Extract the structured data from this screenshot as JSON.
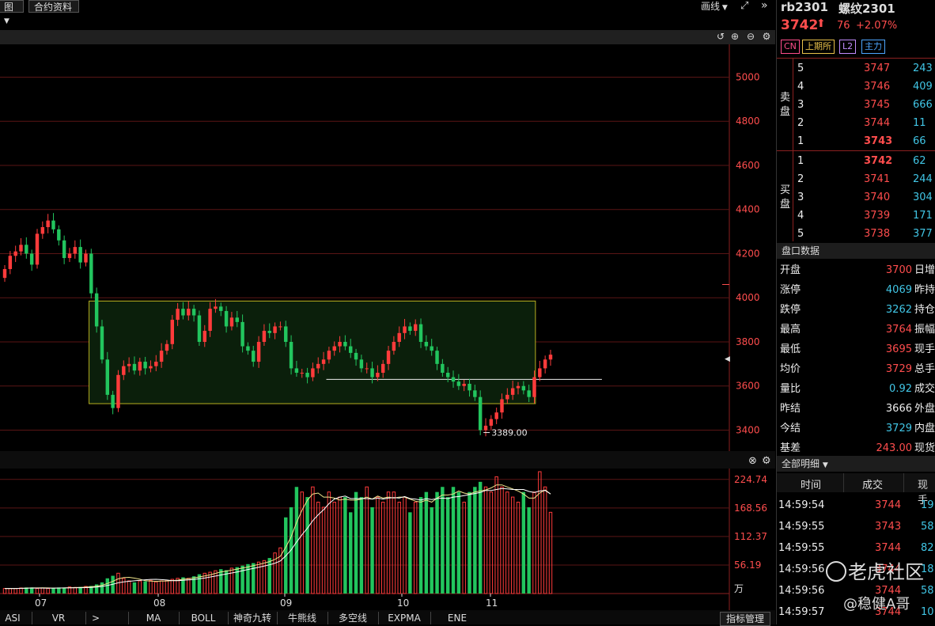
{
  "topbar": {
    "view_dropdown": "图",
    "contract_info": "合约资料",
    "draw_line": "画线"
  },
  "chart_data": [
    {
      "type": "candlestick",
      "title": "",
      "y_axis_ticks": [
        5000,
        4800,
        4600,
        4400,
        4200,
        4000,
        3800,
        3600,
        3400
      ],
      "ylim": [
        3330,
        5120
      ],
      "x_ticks": [
        "07",
        "08",
        "09",
        "10",
        "11"
      ],
      "annotation_low": "3389.00",
      "box_zone": {
        "low": 3520,
        "high": 3985
      },
      "support_line": 3630,
      "closes": [
        4130,
        4190,
        4210,
        4240,
        4200,
        4150,
        4290,
        4320,
        4350,
        4310,
        4260,
        4180,
        4200,
        4230,
        4160,
        4200,
        4020,
        3870,
        3720,
        3560,
        3500,
        3650,
        3690,
        3700,
        3670,
        3710,
        3680,
        3690,
        3710,
        3760,
        3790,
        3900,
        3950,
        3920,
        3950,
        3920,
        3800,
        3850,
        3950,
        3960,
        3940,
        3870,
        3910,
        3890,
        3780,
        3760,
        3710,
        3800,
        3850,
        3840,
        3870,
        3870,
        3800,
        3680,
        3660,
        3660,
        3640,
        3680,
        3700,
        3720,
        3760,
        3780,
        3800,
        3780,
        3750,
        3720,
        3680,
        3680,
        3640,
        3660,
        3700,
        3760,
        3800,
        3840,
        3870,
        3850,
        3880,
        3800,
        3780,
        3760,
        3700,
        3660,
        3640,
        3620,
        3600,
        3610,
        3580,
        3550,
        3400,
        3420,
        3450,
        3480,
        3540,
        3560,
        3590,
        3600,
        3580,
        3550,
        3640,
        3680,
        3720,
        3742
      ]
    },
    {
      "type": "bar",
      "title": "",
      "y_axis_ticks": [
        224.74,
        168.56,
        112.37,
        56.19
      ],
      "ylim": [
        0,
        240
      ],
      "unit": "万",
      "values": [
        10,
        10,
        10,
        11,
        12,
        12,
        10,
        11,
        10,
        11,
        12,
        11,
        13,
        12,
        13,
        14,
        15,
        18,
        22,
        30,
        35,
        40,
        30,
        25,
        22,
        25,
        24,
        26,
        23,
        25,
        26,
        28,
        30,
        32,
        30,
        34,
        38,
        40,
        42,
        45,
        48,
        46,
        50,
        52,
        55,
        58,
        60,
        62,
        65,
        70,
        80,
        90,
        150,
        170,
        210,
        200,
        190,
        210,
        180,
        170,
        200,
        180,
        190,
        190,
        160,
        200,
        190,
        210,
        170,
        190,
        180,
        200,
        200,
        180,
        190,
        160,
        180,
        190,
        200,
        170,
        200,
        210,
        190,
        210,
        200,
        180,
        200,
        210,
        220,
        210,
        200,
        230,
        210,
        200,
        190,
        180,
        200,
        170,
        200,
        240,
        210,
        160
      ]
    }
  ],
  "chart_labels": {
    "high_price_scale_unit": "万",
    "current_price_marker": "◀"
  },
  "bottombar": {
    "tabs": [
      "ASI",
      "VR",
      ">",
      "MA",
      "BOLL",
      "神奇九转",
      "牛熊线",
      "多空线",
      "EXPMA",
      "ENE"
    ],
    "indicator_mgmt": "指标管理"
  },
  "rightpanel": {
    "code": "rb2301",
    "name": "螺纹2301",
    "price": "3742",
    "change": "76",
    "change_pct": "+2.07%",
    "badges": [
      "CN",
      "上期所",
      "L2",
      "主力"
    ],
    "sell_label": [
      "卖",
      "盘"
    ],
    "buy_label": [
      "买",
      "盘"
    ],
    "asks": [
      {
        "level": "5",
        "price": "3747",
        "vol": "243"
      },
      {
        "level": "4",
        "price": "3746",
        "vol": "409"
      },
      {
        "level": "3",
        "price": "3745",
        "vol": "666"
      },
      {
        "level": "2",
        "price": "3744",
        "vol": "11"
      },
      {
        "level": "1",
        "price": "3743",
        "vol": "66"
      }
    ],
    "bids": [
      {
        "level": "1",
        "price": "3742",
        "vol": "62"
      },
      {
        "level": "2",
        "price": "3741",
        "vol": "244"
      },
      {
        "level": "3",
        "price": "3740",
        "vol": "304"
      },
      {
        "level": "4",
        "price": "3739",
        "vol": "171"
      },
      {
        "level": "5",
        "price": "3738",
        "vol": "377"
      }
    ],
    "market_data_title": "盘口数据",
    "market_rows": [
      {
        "label": "开盘",
        "value": "3700",
        "color": "red",
        "extra": "日增"
      },
      {
        "label": "涨停",
        "value": "4069",
        "color": "cyan",
        "extra": "昨持"
      },
      {
        "label": "跌停",
        "value": "3262",
        "color": "cyan",
        "extra": "持仓"
      },
      {
        "label": "最高",
        "value": "3764",
        "color": "red",
        "extra": "振幅"
      },
      {
        "label": "最低",
        "value": "3695",
        "color": "red",
        "extra": "现手"
      },
      {
        "label": "均价",
        "value": "3729",
        "color": "red",
        "extra": "总手"
      },
      {
        "label": "量比",
        "value": "0.92",
        "color": "cyan",
        "extra": "成交"
      },
      {
        "label": "昨结",
        "value": "3666",
        "color": "white",
        "extra": "外盘"
      },
      {
        "label": "今结",
        "value": "3729",
        "color": "cyan",
        "extra": "内盘"
      },
      {
        "label": "基差",
        "value": "243.00",
        "color": "red",
        "extra": "现货"
      }
    ],
    "detail_title": "全部明细",
    "detail_headers": [
      "时间",
      "成交",
      "现手"
    ],
    "details": [
      {
        "time": "14:59:54",
        "price": "3744",
        "vol": "19"
      },
      {
        "time": "14:59:55",
        "price": "3743",
        "vol": "58"
      },
      {
        "time": "14:59:55",
        "price": "3744",
        "vol": "82"
      },
      {
        "time": "14:59:56",
        "price": "3744",
        "vol": "18"
      },
      {
        "time": "14:59:56",
        "price": "3744",
        "vol": "58"
      },
      {
        "time": "14:59:57",
        "price": "3744",
        "vol": "10"
      }
    ]
  },
  "watermark": {
    "brand": "老虎社区",
    "author": "@稳健A哥"
  }
}
